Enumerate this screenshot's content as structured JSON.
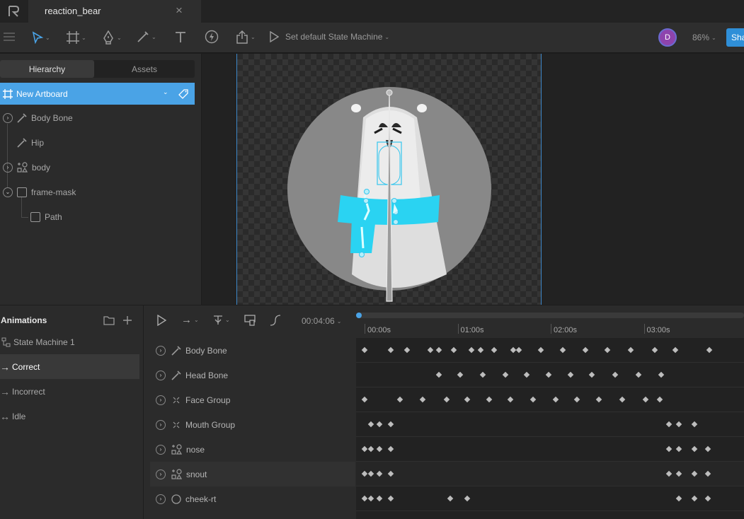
{
  "app": {
    "logo": "rive-logo",
    "tab_title": "reaction_bear",
    "tab_close": "×"
  },
  "toolbar": {
    "state_machine_label": "Set default State Machine",
    "avatar_initial": "D",
    "zoom": "86%",
    "share_label": "Sha",
    "tools": [
      "menu-icon",
      "select-tool-icon",
      "artboard-tool-icon",
      "pen-tool-icon",
      "bone-tool-icon",
      "text-tool-icon",
      "event-tool-icon",
      "export-icon",
      "play-icon"
    ]
  },
  "hierarchy": {
    "tabs": [
      "Hierarchy",
      "Assets"
    ],
    "active_tab": "Hierarchy",
    "artboard_label": "New Artboard",
    "items": [
      {
        "label": "Body Bone",
        "icon": "bone-icon"
      },
      {
        "label": "Hip",
        "icon": "bone-icon"
      },
      {
        "label": "body",
        "icon": "group-shapes-icon"
      },
      {
        "label": "frame-mask",
        "icon": "square-icon"
      },
      {
        "label": "Path",
        "icon": "square-icon"
      }
    ]
  },
  "animations": {
    "title": "Animations",
    "items": [
      {
        "label": "State Machine 1",
        "icon": "state-machine-icon"
      },
      {
        "label": "Correct",
        "icon": "arrow-right-icon",
        "selected": true
      },
      {
        "label": "Incorrect",
        "icon": "arrow-right-icon"
      },
      {
        "label": "Idle",
        "icon": "loop-icon"
      }
    ]
  },
  "timeline": {
    "duration": "00:04:06",
    "ticks": [
      "00:00s",
      "01:00s",
      "02:00s",
      "03:00s"
    ],
    "playhead_seconds": 0,
    "tracks": [
      {
        "label": "Body Bone",
        "icon": "bone-icon",
        "keys_s": [
          0,
          0.28,
          0.46,
          0.71,
          0.8,
          0.96,
          1.15,
          1.25,
          1.39,
          1.6,
          1.66,
          1.89,
          2.13,
          2.37,
          2.61,
          2.86,
          3.12,
          3.34,
          3.7
        ]
      },
      {
        "label": "Head Bone",
        "icon": "bone-icon",
        "keys_s": [
          0.8,
          1.03,
          1.27,
          1.51,
          1.74,
          1.98,
          2.21,
          2.44,
          2.69,
          2.94,
          3.19
        ]
      },
      {
        "label": "Face Group",
        "icon": "group-icon",
        "keys_s": [
          0,
          0.38,
          0.62,
          0.88,
          1.1,
          1.34,
          1.57,
          1.81,
          2.05,
          2.28,
          2.52,
          2.77,
          3.02,
          3.17
        ]
      },
      {
        "label": "Mouth Group",
        "icon": "group-icon",
        "keys_s": [
          0.07,
          0.16,
          0.28,
          3.27,
          3.38,
          3.54
        ]
      },
      {
        "label": "nose",
        "icon": "group-shapes-icon",
        "keys_s": [
          0,
          0.07,
          0.16,
          0.28,
          3.27,
          3.38,
          3.54,
          3.69
        ]
      },
      {
        "label": "snout",
        "icon": "group-shapes-icon",
        "keys_s": [
          0,
          0.07,
          0.16,
          0.28,
          3.27,
          3.38,
          3.54,
          3.69
        ]
      },
      {
        "label": "cheek-rt",
        "icon": "circle-icon",
        "keys_s": [
          0,
          0.07,
          0.16,
          0.28,
          0.92,
          1.1,
          3.38,
          3.54,
          3.69
        ]
      }
    ]
  },
  "colors": {
    "accent": "#4aa3e6",
    "selection_blue": "#4aa3e6",
    "keyframe": "#bdbdbd",
    "avatar": "#8e44ad",
    "scarf": "#2ad3f2"
  }
}
